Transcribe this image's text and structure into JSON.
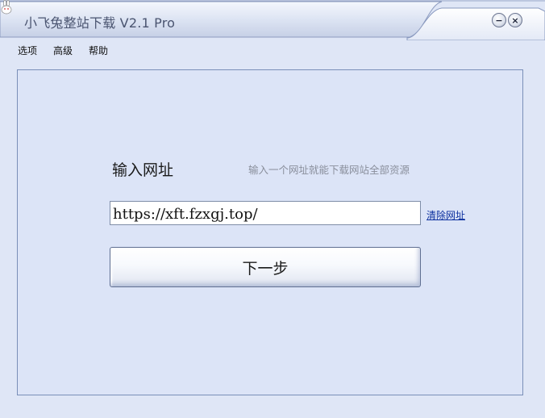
{
  "window": {
    "title": "小飞兔整站下载 V2.1 Pro",
    "icon": "rabbit-icon",
    "minimize_symbol": "−",
    "close_symbol": "×"
  },
  "menu": {
    "items": [
      {
        "label": "选项"
      },
      {
        "label": "高级"
      },
      {
        "label": "帮助"
      }
    ]
  },
  "form": {
    "label": "输入网址",
    "hint": "输入一个网址就能下载网站全部资源",
    "url_value": "https://xft.fzxgj.top/",
    "clear_link": "清除网址",
    "next_button": "下一步"
  },
  "colors": {
    "window_bg": "#dfe6f6",
    "panel_border": "#7a8fb8",
    "link": "#0b2f9e",
    "hint_text": "#8a8f9c"
  }
}
